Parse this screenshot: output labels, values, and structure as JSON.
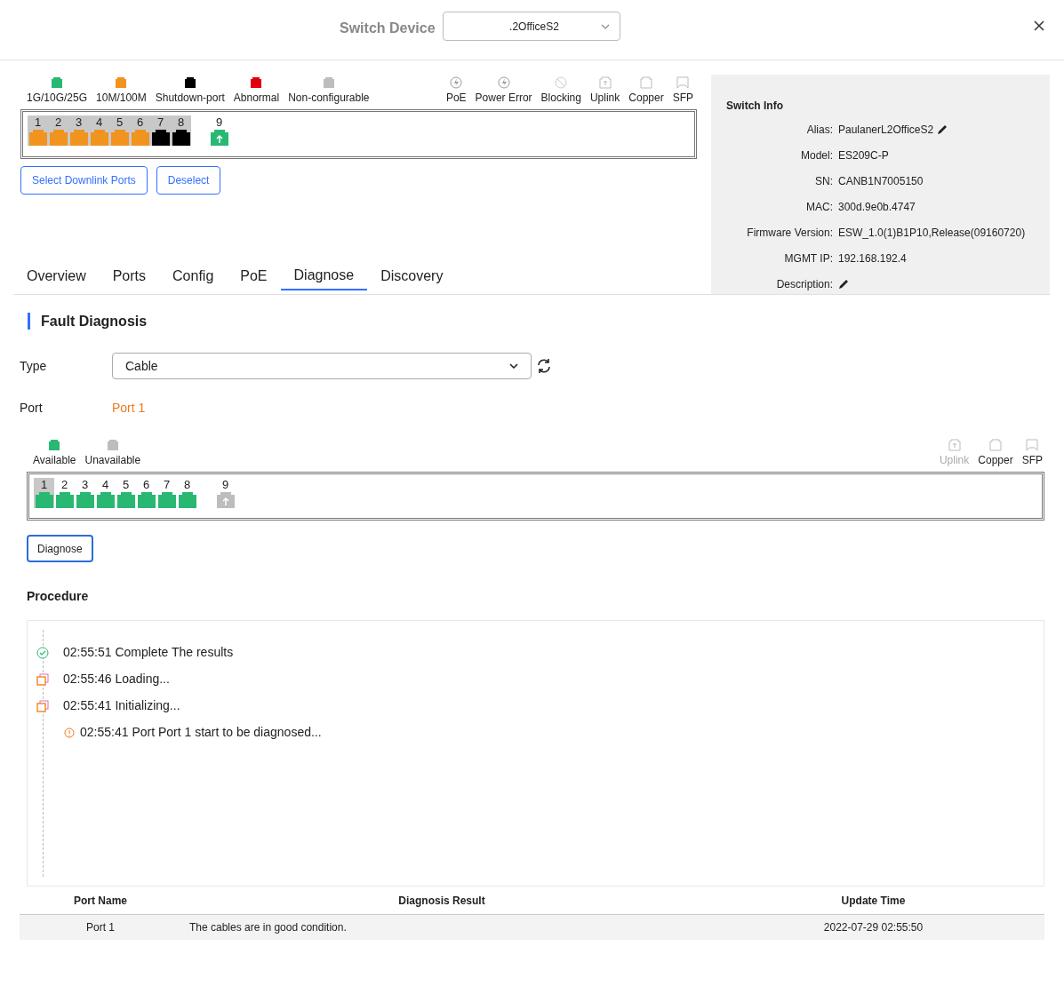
{
  "header": {
    "label": "Switch Device",
    "device_select": ".2OfficeS2"
  },
  "status_legend": [
    {
      "label": "1G/10G/25G",
      "color": "#29b872"
    },
    {
      "label": "10M/100M",
      "color": "#f0931f"
    },
    {
      "label": "Shutdown-port",
      "color": "#000000"
    },
    {
      "label": "Abnormal",
      "color": "#e0000f"
    },
    {
      "label": "Non-configurable",
      "color": "#bdbdbd"
    }
  ],
  "type_legend": [
    {
      "kind": "poe",
      "label": "PoE",
      "disabled": false
    },
    {
      "kind": "power_error",
      "label": "Power Error",
      "disabled": false
    },
    {
      "kind": "blocking",
      "label": "Blocking",
      "disabled": false
    },
    {
      "kind": "uplink",
      "label": "Uplink",
      "disabled": false
    },
    {
      "kind": "copper",
      "label": "Copper",
      "disabled": false
    },
    {
      "kind": "sfp",
      "label": "SFP",
      "disabled": false
    }
  ],
  "ports": [
    {
      "number": "1",
      "kind": "copper",
      "color": "#f0931f",
      "selected": true
    },
    {
      "number": "2",
      "kind": "copper",
      "color": "#f0931f",
      "selected": true
    },
    {
      "number": "3",
      "kind": "copper",
      "color": "#f0931f",
      "selected": true
    },
    {
      "number": "4",
      "kind": "copper",
      "color": "#f0931f",
      "selected": true
    },
    {
      "number": "5",
      "kind": "copper",
      "color": "#f0931f",
      "selected": true
    },
    {
      "number": "6",
      "kind": "copper",
      "color": "#f0931f",
      "selected": true
    },
    {
      "number": "7",
      "kind": "copper",
      "color": "#000000",
      "selected": true
    },
    {
      "number": "8",
      "kind": "copper",
      "color": "#000000",
      "selected": true
    },
    {
      "number": "9",
      "kind": "uplink",
      "color": "#29b872",
      "selected": false
    }
  ],
  "port_buttons": [
    "Select Downlink Ports",
    "Deselect"
  ],
  "tabs": [
    {
      "label": "Overview",
      "selected": false
    },
    {
      "label": "Ports",
      "selected": false
    },
    {
      "label": "Config",
      "selected": false
    },
    {
      "label": "PoE",
      "selected": false
    },
    {
      "label": "Diagnose",
      "selected": true
    },
    {
      "label": "Discovery",
      "selected": false
    }
  ],
  "switch_info": {
    "title": "Switch Info",
    "fields": [
      {
        "label": "Alias:",
        "value": "PaulanerL2OfficeS2",
        "editable": true
      },
      {
        "label": "Model:",
        "value": "ES209C-P",
        "editable": false
      },
      {
        "label": "SN:",
        "value": "CANB1N7005150",
        "editable": false
      },
      {
        "label": "MAC:",
        "value": "300d.9e0b.4747",
        "editable": false
      },
      {
        "label": "Firmware Version:",
        "value": "ESW_1.0(1)B1P10,Release(09160720)",
        "editable": false
      },
      {
        "label": "MGMT IP:",
        "value": "192.168.192.4",
        "editable": false
      },
      {
        "label": "Description:",
        "editable": true
      }
    ]
  },
  "fault_diagnosis": {
    "title": "Fault Diagnosis",
    "type_label": "Type",
    "type_value": "Cable",
    "port_label": "Port",
    "port_value": "Port 1",
    "status_legend": [
      {
        "label": "Available",
        "color": "#29b872"
      },
      {
        "label": "Unavailable",
        "color": "#bdbdbd"
      }
    ],
    "type_legend": [
      {
        "kind": "uplink",
        "label": "Uplink",
        "disabled": true
      },
      {
        "kind": "copper",
        "label": "Copper",
        "disabled": false
      },
      {
        "kind": "sfp",
        "label": "SFP",
        "disabled": false
      }
    ],
    "ports": [
      {
        "number": "1",
        "kind": "copper",
        "color": "#29b872",
        "selected": true
      },
      {
        "number": "2",
        "kind": "copper",
        "color": "#29b872",
        "selected": false
      },
      {
        "number": "3",
        "kind": "copper",
        "color": "#29b872",
        "selected": false
      },
      {
        "number": "4",
        "kind": "copper",
        "color": "#29b872",
        "selected": false
      },
      {
        "number": "5",
        "kind": "copper",
        "color": "#29b872",
        "selected": false
      },
      {
        "number": "6",
        "kind": "copper",
        "color": "#29b872",
        "selected": false
      },
      {
        "number": "7",
        "kind": "copper",
        "color": "#29b872",
        "selected": false
      },
      {
        "number": "8",
        "kind": "copper",
        "color": "#29b872",
        "selected": false
      },
      {
        "number": "9",
        "kind": "uplink",
        "color": "#bdbdbd",
        "selected": false
      }
    ],
    "diagnose_button": "Diagnose"
  },
  "procedure": {
    "title": "Procedure",
    "steps": [
      {
        "kind": "success",
        "text": "02:55:51 Complete The results"
      },
      {
        "kind": "loading",
        "text": "02:55:46 Loading..."
      },
      {
        "kind": "loading",
        "text": "02:55:41 Initializing..."
      },
      {
        "kind": "info",
        "text": "02:55:41 Port Port 1 start to be diagnosed..."
      }
    ]
  },
  "results_table": {
    "columns": [
      "Port Name",
      "Diagnosis Result",
      "Update Time"
    ],
    "rows": [
      [
        "Port 1",
        "The cables are in good condition.",
        "2022-07-29 02:55:50"
      ]
    ]
  }
}
